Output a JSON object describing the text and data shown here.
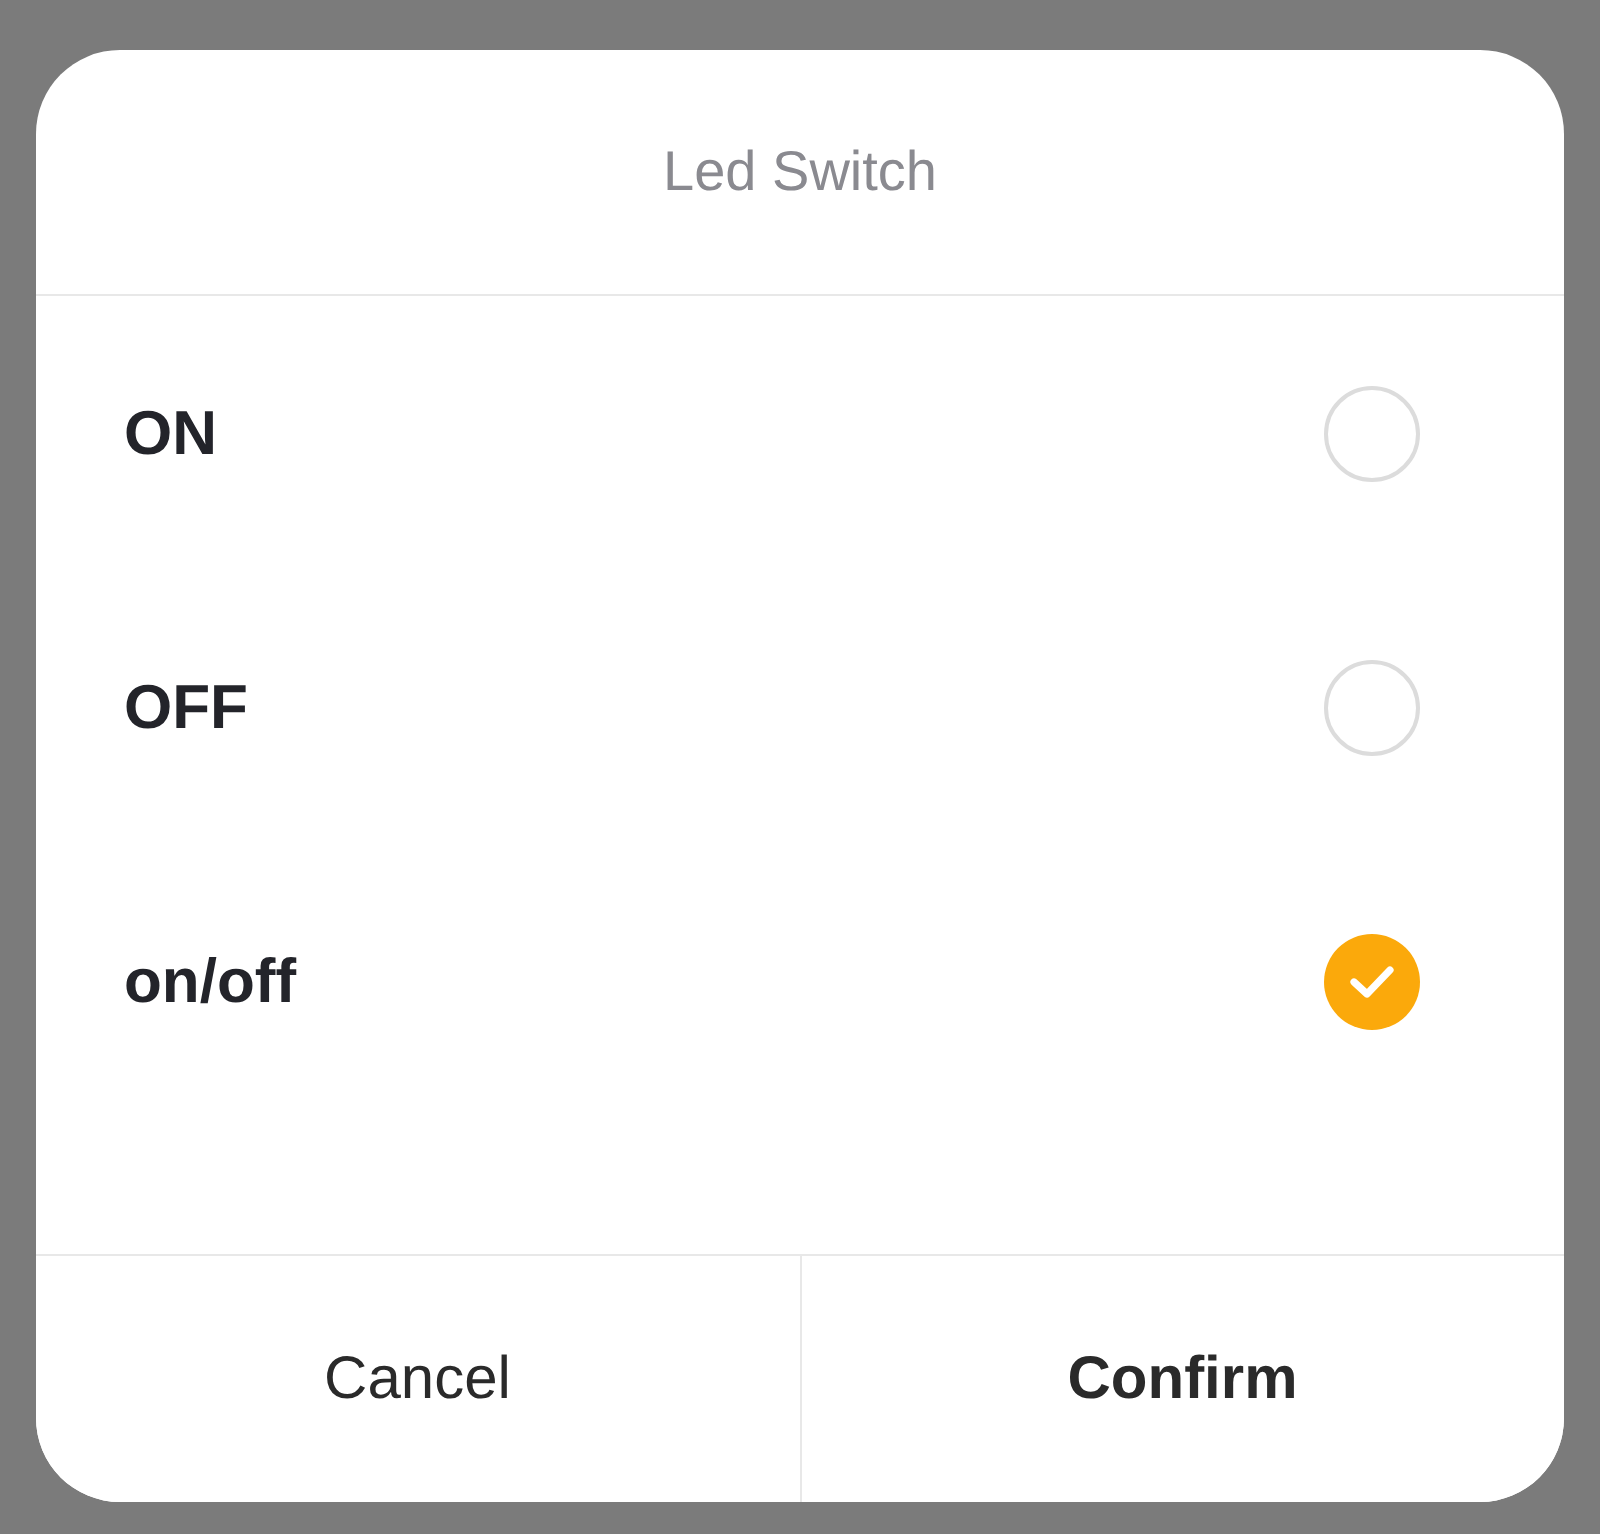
{
  "dialog": {
    "title": "Led Switch",
    "options": [
      {
        "label": "ON",
        "selected": false
      },
      {
        "label": "OFF",
        "selected": false
      },
      {
        "label": "on/off",
        "selected": true
      }
    ],
    "buttons": [
      {
        "label": "Cancel",
        "kind": "secondary"
      },
      {
        "label": "Confirm",
        "kind": "primary"
      }
    ]
  }
}
